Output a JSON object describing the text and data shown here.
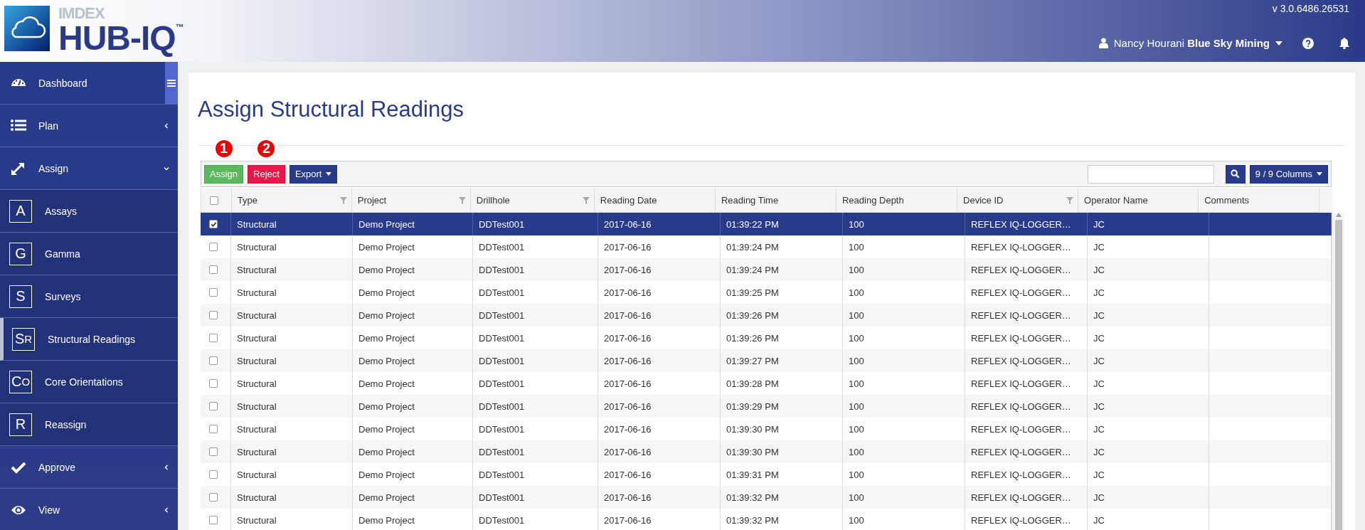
{
  "header": {
    "logo_brand": "IMDEX",
    "logo_product": "HUB-IQ",
    "logo_mark": "™",
    "version": "v 3.0.6486.26531",
    "user_menu": "Nancy Hourani **Blue Sky Mining**"
  },
  "sidebar": {
    "items": [
      {
        "kind": "icon",
        "label": "Dashboard",
        "toggle": true,
        "selected": false
      },
      {
        "kind": "icon",
        "label": "Plan",
        "expanded": false,
        "selected": false
      },
      {
        "kind": "icon",
        "label": "Assign",
        "expanded": true,
        "selected": false,
        "children": [
          {
            "kind": "letter",
            "letter": "A",
            "label": "Assays",
            "selected": false
          },
          {
            "kind": "letter",
            "letter": "G",
            "label": "Gamma",
            "selected": false
          },
          {
            "kind": "letter",
            "letter": "S",
            "label": "Surveys",
            "selected": false
          },
          {
            "kind": "letter",
            "letter": "SR",
            "label": "Structural Readings",
            "selected": true
          },
          {
            "kind": "letter",
            "letter": "CO",
            "label": "Core Orientations",
            "selected": false
          },
          {
            "kind": "letter",
            "letter": "R",
            "label": "Reassign",
            "selected": false
          }
        ]
      },
      {
        "kind": "icon",
        "label": "Approve",
        "expanded": false,
        "selected": false
      },
      {
        "kind": "icon",
        "label": "View",
        "expanded": false,
        "selected": false
      }
    ]
  },
  "page": {
    "title": "Assign Structural Readings",
    "toolbar": {
      "buttons": [
        {
          "kind": "success",
          "label": "Assign",
          "marker": "1"
        },
        {
          "kind": "danger",
          "label": "Reject",
          "marker": "2"
        },
        {
          "kind": "dropdown",
          "label": "Export"
        }
      ],
      "columns_button": "9 / 9 Columns"
    },
    "table": {
      "select_all": {
        "checked": false
      },
      "columns": [
        {
          "label": "Type",
          "filterable": true
        },
        {
          "label": "Project",
          "filterable": true
        },
        {
          "label": "Drillhole",
          "filterable": true
        },
        {
          "label": "Reading Date",
          "filterable": false
        },
        {
          "label": "Reading Time",
          "filterable": false
        },
        {
          "label": "Reading Depth",
          "filterable": false
        },
        {
          "label": "Device ID",
          "filterable": true
        },
        {
          "label": "Operator Name",
          "filterable": false
        },
        {
          "label": "Comments",
          "filterable": false
        }
      ],
      "rows": [
        {
          "selected": true,
          "cells": [
            "Structural",
            "Demo Project",
            "DDTest001",
            "2017-06-16",
            "01:39:22 PM",
            "100",
            "REFLEX IQ-LOGGER…",
            "JC",
            ""
          ]
        },
        {
          "selected": false,
          "cells": [
            "Structural",
            "Demo Project",
            "DDTest001",
            "2017-06-16",
            "01:39:24 PM",
            "100",
            "REFLEX IQ-LOGGER…",
            "JC",
            ""
          ]
        },
        {
          "selected": false,
          "cells": [
            "Structural",
            "Demo Project",
            "DDTest001",
            "2017-06-16",
            "01:39:24 PM",
            "100",
            "REFLEX IQ-LOGGER…",
            "JC",
            ""
          ]
        },
        {
          "selected": false,
          "cells": [
            "Structural",
            "Demo Project",
            "DDTest001",
            "2017-06-16",
            "01:39:25 PM",
            "100",
            "REFLEX IQ-LOGGER…",
            "JC",
            ""
          ]
        },
        {
          "selected": false,
          "cells": [
            "Structural",
            "Demo Project",
            "DDTest001",
            "2017-06-16",
            "01:39:26 PM",
            "100",
            "REFLEX IQ-LOGGER…",
            "JC",
            ""
          ]
        },
        {
          "selected": false,
          "cells": [
            "Structural",
            "Demo Project",
            "DDTest001",
            "2017-06-16",
            "01:39:26 PM",
            "100",
            "REFLEX IQ-LOGGER…",
            "JC",
            ""
          ]
        },
        {
          "selected": false,
          "cells": [
            "Structural",
            "Demo Project",
            "DDTest001",
            "2017-06-16",
            "01:39:27 PM",
            "100",
            "REFLEX IQ-LOGGER…",
            "JC",
            ""
          ]
        },
        {
          "selected": false,
          "cells": [
            "Structural",
            "Demo Project",
            "DDTest001",
            "2017-06-16",
            "01:39:28 PM",
            "100",
            "REFLEX IQ-LOGGER…",
            "JC",
            ""
          ]
        },
        {
          "selected": false,
          "cells": [
            "Structural",
            "Demo Project",
            "DDTest001",
            "2017-06-16",
            "01:39:29 PM",
            "100",
            "REFLEX IQ-LOGGER…",
            "JC",
            ""
          ]
        },
        {
          "selected": false,
          "cells": [
            "Structural",
            "Demo Project",
            "DDTest001",
            "2017-06-16",
            "01:39:30 PM",
            "100",
            "REFLEX IQ-LOGGER…",
            "JC",
            ""
          ]
        },
        {
          "selected": false,
          "cells": [
            "Structural",
            "Demo Project",
            "DDTest001",
            "2017-06-16",
            "01:39:30 PM",
            "100",
            "REFLEX IQ-LOGGER…",
            "JC",
            ""
          ]
        },
        {
          "selected": false,
          "cells": [
            "Structural",
            "Demo Project",
            "DDTest001",
            "2017-06-16",
            "01:39:31 PM",
            "100",
            "REFLEX IQ-LOGGER…",
            "JC",
            ""
          ]
        },
        {
          "selected": false,
          "cells": [
            "Structural",
            "Demo Project",
            "DDTest001",
            "2017-06-16",
            "01:39:32 PM",
            "100",
            "REFLEX IQ-LOGGER…",
            "JC",
            ""
          ]
        },
        {
          "selected": false,
          "cells": [
            "Structural",
            "Demo Project",
            "DDTest001",
            "2017-06-16",
            "01:39:32 PM",
            "100",
            "REFLEX IQ-LOGGER…",
            "JC",
            ""
          ]
        }
      ]
    }
  }
}
